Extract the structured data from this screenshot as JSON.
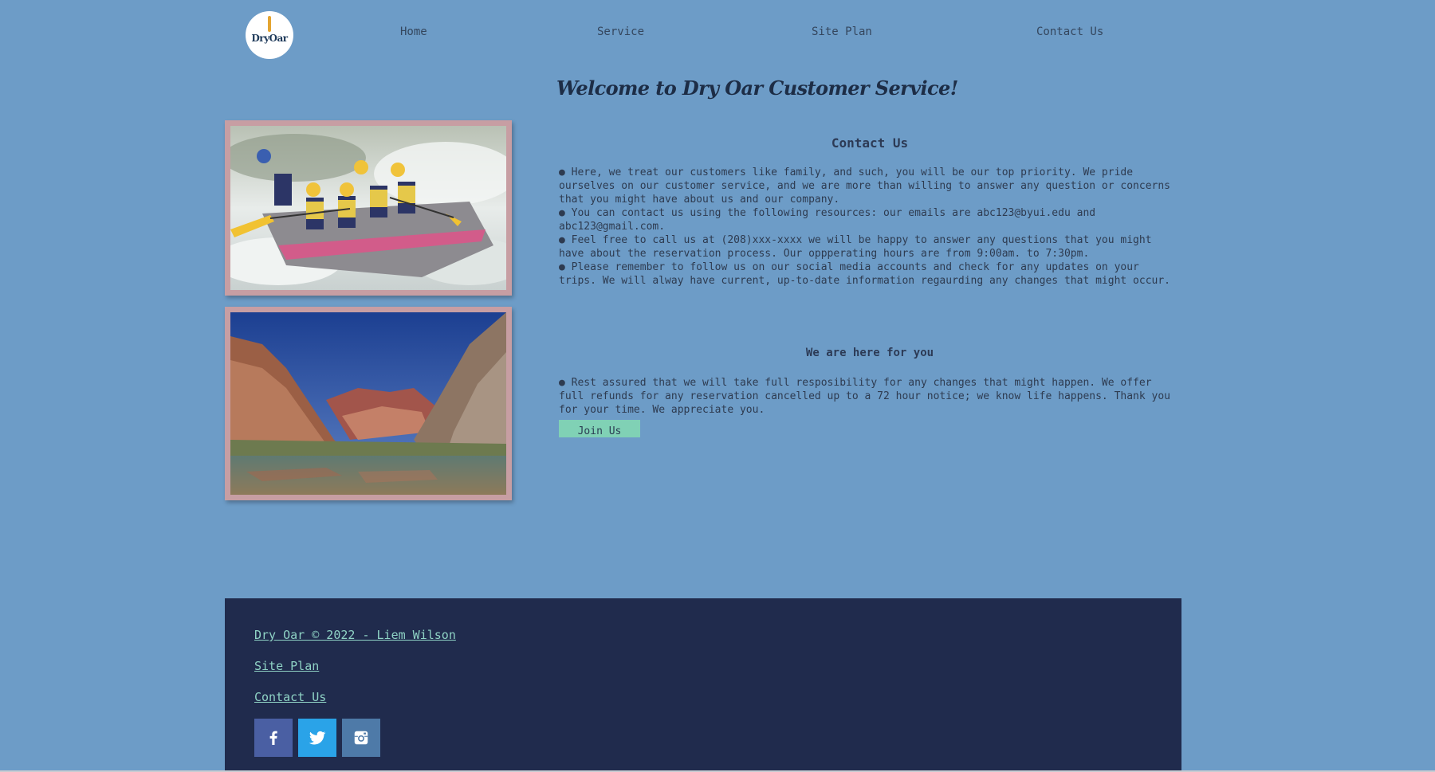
{
  "brand": {
    "logo_text": "DryOar"
  },
  "nav": {
    "items": [
      {
        "label": "Home"
      },
      {
        "label": "Service"
      },
      {
        "label": "Site Plan"
      },
      {
        "label": "Contact Us"
      }
    ]
  },
  "main": {
    "welcome": "Welcome to Dry Oar Customer Service!",
    "contact": {
      "title": "Contact Us",
      "text": "● Here, we treat our customers like family, and such, you will be our top priority. We pride ourselves on our customer service, and we are more than willing to answer any question or concerns that you might have about us and our company.\n● You can contact us using the following resources: our emails are abc123@byui.edu and abc123@gmail.com.\n● Feel free to call us at (208)xxx-xxxx we will be happy to answer any questions that you might have about the reservation process. Our oppperating hours are from 9:00am. to 7:30pm.\n● Please remember to follow us on our social media accounts and check for any updates on your trips. We will alway have current, up-to-date information regaurding any changes that might occur."
    },
    "support": {
      "title": "We are here for you",
      "text": "● Rest assured that we will take full resposibility for any changes that might happen. We offer full refunds for any reservation cancelled up to a 72 hour notice; we know life happens. Thank you for your time. We appreciate you."
    },
    "join_button": "Join Us"
  },
  "footer": {
    "copyright": "Dry Oar © 2022 - Liem Wilson",
    "site_plan": "Site Plan",
    "contact": "Contact Us",
    "social": [
      {
        "icon": "facebook-icon",
        "color": "#4a5fa3"
      },
      {
        "icon": "twitter-icon",
        "color": "#2aa3e8"
      },
      {
        "icon": "instagram-icon",
        "color": "#4e7aa8"
      }
    ]
  },
  "colors": {
    "page_bg": "#6d9cc7",
    "photo_border": "#c79ea3",
    "footer_bg": "#202b4d",
    "footer_link": "#8fd3c5",
    "button_bg": "#80d1b5"
  }
}
